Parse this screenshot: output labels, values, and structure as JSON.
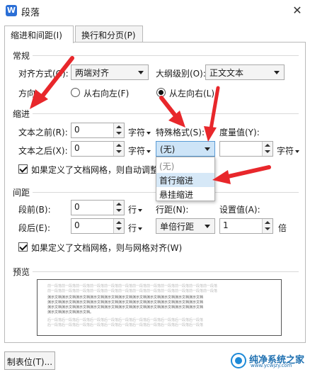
{
  "window": {
    "title": "段落",
    "app_icon_letter": "W",
    "close_glyph": "✕"
  },
  "tabs": [
    {
      "label": "缩进和间距(I)",
      "active": true
    },
    {
      "label": "换行和分页(P)",
      "active": false
    }
  ],
  "general": {
    "section": "常规",
    "align_label": "对齐方式(G):",
    "align_value": "两端对齐",
    "outline_label": "大纲级别(O):",
    "outline_value": "正文文本",
    "direction_label": "方向:",
    "rtl_label": "从右向左(F)",
    "ltr_label": "从左向右(L)",
    "direction_selected": "ltr"
  },
  "indent": {
    "section": "缩进",
    "before_label": "文本之前(R):",
    "before_value": "0",
    "before_unit": "字符",
    "after_label": "文本之后(X):",
    "after_value": "0",
    "after_unit": "字符",
    "special_label": "特殊格式(S):",
    "special_value": "(无)",
    "measure_label": "度量值(Y):",
    "measure_value": "",
    "measure_unit": "字符",
    "grid_checkbox_label": "如果定义了文档网格，则自动调整",
    "grid_checked": true,
    "special_options": [
      {
        "label": "(无)",
        "state": "disabled"
      },
      {
        "label": "首行缩进",
        "state": "hover"
      },
      {
        "label": "悬挂缩进",
        "state": "normal"
      }
    ]
  },
  "spacing": {
    "section": "间距",
    "before_label": "段前(B):",
    "before_value": "0",
    "before_unit": "行",
    "after_label": "段后(E):",
    "after_value": "0",
    "after_unit": "行",
    "line_label": "行距(N):",
    "line_value": "单倍行距",
    "setting_label": "设置值(A):",
    "setting_value": "1",
    "setting_unit": "倍",
    "grid_checkbox_label": "如果定义了文档网格，则与网格对齐(W)",
    "grid_checked": true
  },
  "preview": {
    "section": "预览",
    "prev_line_1": "前一段落前一段落前一段落前一段落前一段落前一段落前一段落前一段落前一段落前一段落前一段落前一段落",
    "prev_line_2": "前一段落前一段落前一段落前一段落前一段落前一段落前一段落前一段落前一段落前一段落前一段落前一段落",
    "sample_line_1": "演示文档演示文档演示文档演示文档演示文档演示文档演示文档演示文档演示文档演示文档演示文档",
    "sample_line_2": "演示文档演示文档演示文档演示文档演示文档演示文档演示文档演示文档演示文档演示文档演示文档",
    "sample_line_3": "演示文档演示文档演示文档演示文档演示文档演示文档演示文档演示文档演示文档演示文档演示文档",
    "sample_line_4": "演示文档演示文档演示文档。",
    "next_line_1": "后一段落后一段落后一段落后一段落后一段落后一段落后一段落后一段落后一段落后一段落后一段落",
    "next_line_2": "后一段落后一段落后一段落后一段落后一段落后一段落后一段落后一段落后一段落后一段落后一段落"
  },
  "footer": {
    "tabs_button": "制表位(T)..."
  },
  "watermark": {
    "title": "纯净系统之家",
    "url": "www.ycwjzy.com"
  },
  "annotation_color": "#e8272b",
  "accent_color": "#2b6fd6"
}
